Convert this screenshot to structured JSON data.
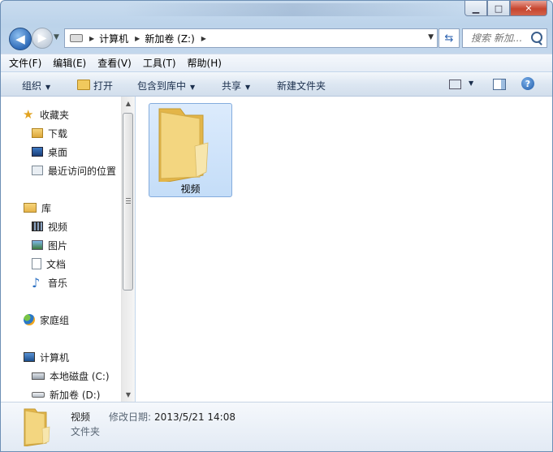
{
  "window": {
    "minimize": "▁",
    "maximize": "□",
    "close": "✕"
  },
  "address": {
    "segments": [
      "计算机",
      "新加卷 (Z:)"
    ]
  },
  "search": {
    "placeholder": "搜索 新加..."
  },
  "menu": [
    "文件(F)",
    "编辑(E)",
    "查看(V)",
    "工具(T)",
    "帮助(H)"
  ],
  "toolbar": {
    "organize": "组织",
    "open": "打开",
    "include": "包含到库中",
    "share": "共享",
    "new_folder": "新建文件夹",
    "help": "?"
  },
  "sidebar": {
    "favorites": {
      "label": "收藏夹",
      "items": [
        "下载",
        "桌面",
        "最近访问的位置"
      ]
    },
    "libraries": {
      "label": "库",
      "items": [
        "视频",
        "图片",
        "文档",
        "音乐"
      ]
    },
    "homegroup": {
      "label": "家庭组"
    },
    "computer": {
      "label": "计算机",
      "items": [
        "本地磁盘 (C:)",
        "新加卷 (D:)"
      ]
    }
  },
  "content": {
    "items": [
      {
        "name": "视频",
        "icon": "folder-icon"
      }
    ]
  },
  "details": {
    "name": "视频",
    "modified_label": "修改日期:",
    "modified_value": "2013/5/21 14:08",
    "type": "文件夹"
  }
}
